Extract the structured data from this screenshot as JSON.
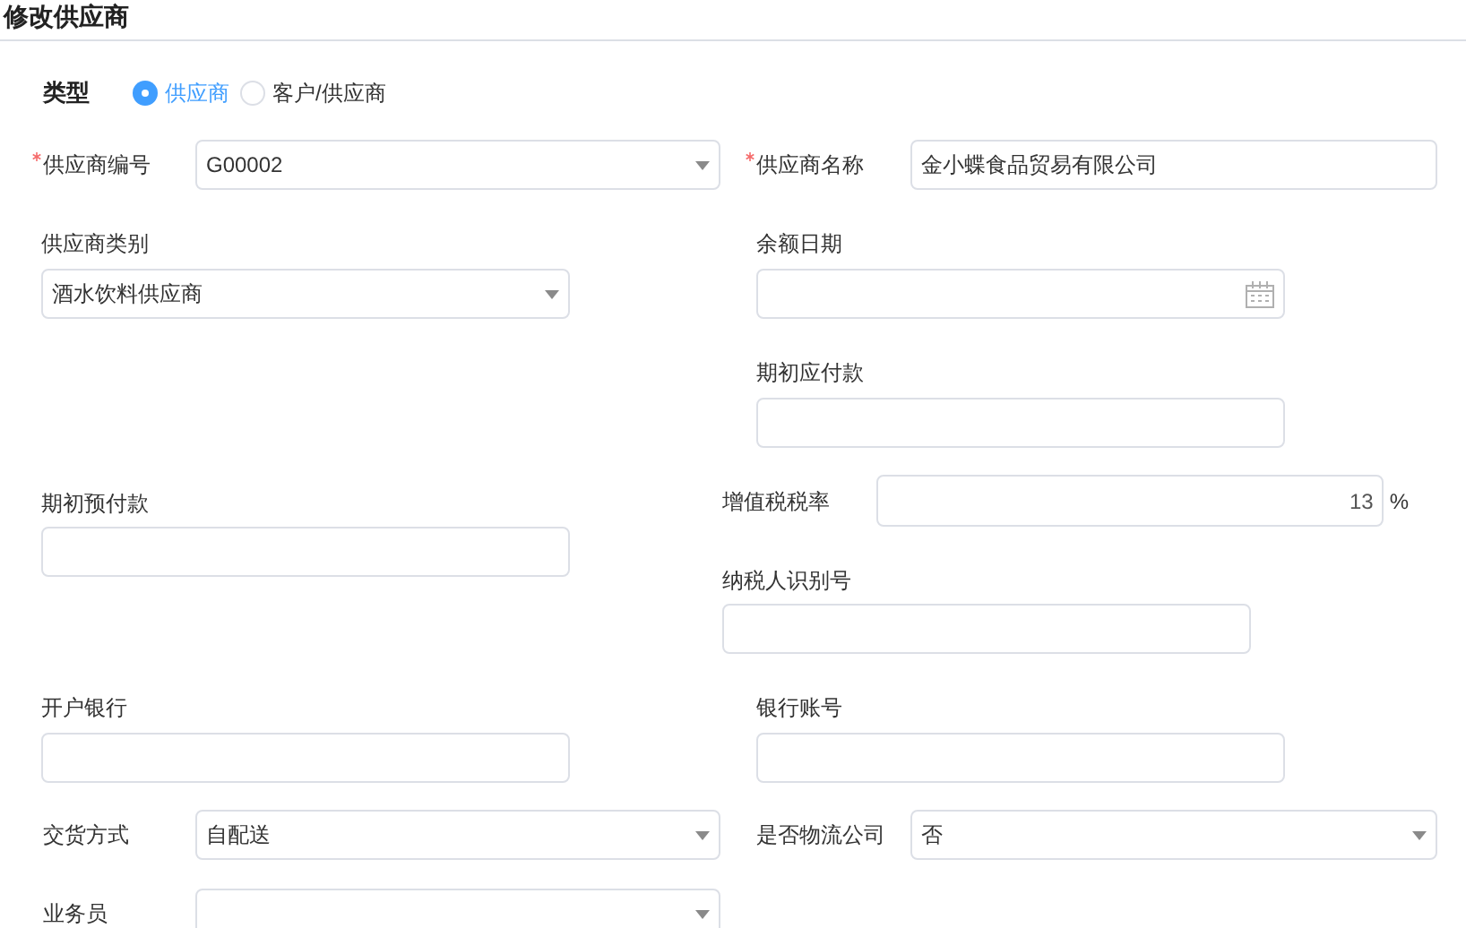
{
  "title": "修改供应商",
  "type": {
    "label": "类型",
    "options": [
      {
        "label": "供应商",
        "selected": true
      },
      {
        "label": "客户/供应商",
        "selected": false
      }
    ]
  },
  "fields": [
    {
      "label": "供应商编号",
      "required": true,
      "kind": "select",
      "value": "G00002"
    },
    {
      "label": "供应商名称",
      "required": true,
      "kind": "text",
      "value": "金小蝶食品贸易有限公司"
    },
    {
      "label": "供应商类别",
      "required": false,
      "kind": "select",
      "value": "酒水饮料供应商"
    },
    {
      "label": "余额日期",
      "required": false,
      "kind": "date"
    },
    {
      "label": "期初应付款",
      "required": false,
      "kind": "text"
    },
    {
      "label": "期初预付款",
      "required": false,
      "kind": "text"
    },
    {
      "label": "增值税税率",
      "required": false,
      "kind": "number",
      "value": "13",
      "unit": "%"
    },
    {
      "label": "纳税人识别号",
      "required": false,
      "kind": "text"
    },
    {
      "label": "开户银行",
      "required": false,
      "kind": "text"
    },
    {
      "label": "银行账号",
      "required": false,
      "kind": "text"
    },
    {
      "label": "交货方式",
      "required": false,
      "kind": "select",
      "value": "自配送"
    },
    {
      "label": "是否物流公司",
      "required": false,
      "kind": "select",
      "value": "否"
    },
    {
      "label": "业务员",
      "required": false,
      "kind": "select"
    }
  ]
}
